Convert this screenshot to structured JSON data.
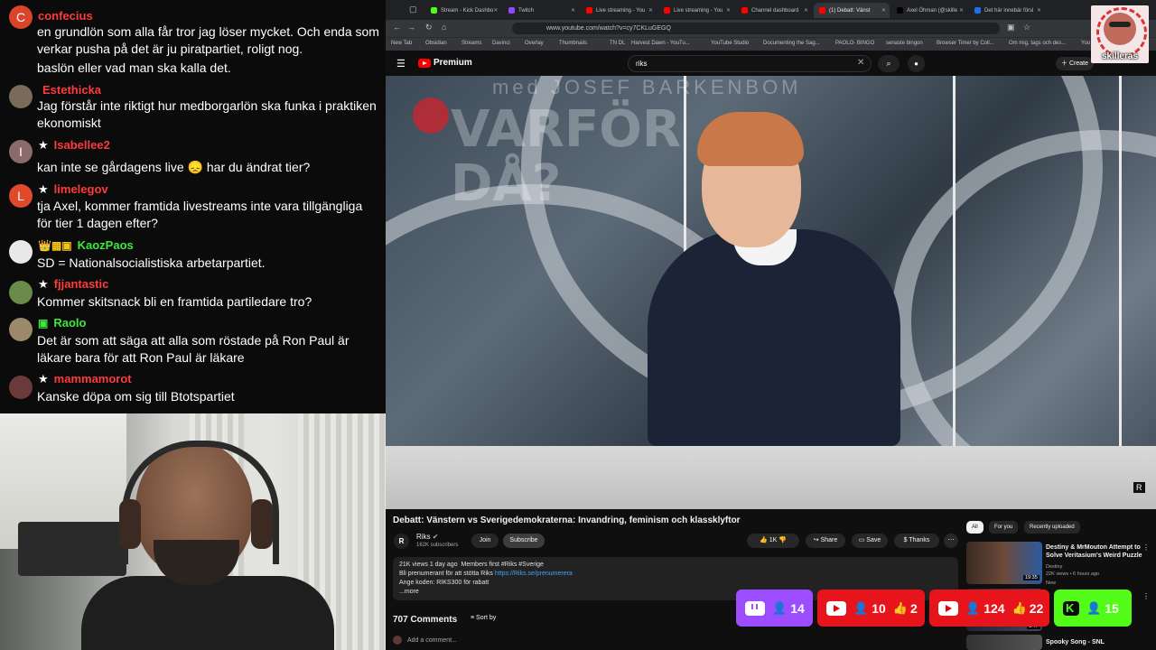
{
  "chat": {
    "messages": [
      {
        "user": "confecius",
        "user_color": "#ff3b3b",
        "avatar_letter": "C",
        "avatar_color": "#d9442b",
        "star": false,
        "badges": "",
        "text": "en grundlön som alla får tror jag löser mycket. Och enda som verkar pusha på det är ju piratpartiet, roligt nog."
      },
      {
        "user": "",
        "user_color": "#ff3b3b",
        "avatar_letter": "",
        "avatar_color": "",
        "star": false,
        "badges": "",
        "text": "baslön eller vad man ska kalla det."
      },
      {
        "user": "Estethicka",
        "user_color": "#ff3b3b",
        "avatar_letter": "",
        "avatar_color": "#7a6a5a",
        "star": false,
        "badges": "",
        "text": "Jag förstår inte riktigt hur medborgarlön ska funka i praktiken ekonomiskt"
      },
      {
        "user": "Isabellee2",
        "user_color": "#ff3b3b",
        "avatar_letter": "I",
        "avatar_color": "#8a6a6a",
        "star": true,
        "badges": "",
        "text": "kan inte se gårdagens live 😞 har du ändrat tier?"
      },
      {
        "user": "limelegov",
        "user_color": "#ff3b3b",
        "avatar_letter": "L",
        "avatar_color": "#e04a2b",
        "star": true,
        "badges": "",
        "text": "tja Axel, kommer framtida livestreams inte vara tillgängliga för tier 1 dagen efter?"
      },
      {
        "user": "KaozPaos",
        "user_color": "#3ee83e",
        "avatar_letter": "",
        "avatar_color": "#e8e8e8",
        "star": false,
        "badges": "👑▦▣",
        "text": "SD = Nationalsocialistiska arbetarpartiet."
      },
      {
        "user": "fjjantastic",
        "user_color": "#ff3b3b",
        "avatar_letter": "",
        "avatar_color": "#6a8a4a",
        "star": true,
        "badges": "",
        "text": "Kommer skitsnack bli en framtida partiledare tro?"
      },
      {
        "user": "Raolo",
        "user_color": "#3ee83e",
        "avatar_letter": "",
        "avatar_color": "#9a8a6a",
        "star": false,
        "badges": "▣",
        "text": "Det är som att säga att alla som röstade på Ron Paul är läkare bara för att Ron Paul är läkare"
      },
      {
        "user": "mammamorot",
        "user_color": "#ff3b3b",
        "avatar_letter": "",
        "avatar_color": "#6a3a3a",
        "star": true,
        "badges": "",
        "text": "Kanske döpa om sig till Btotspartiet"
      }
    ]
  },
  "browser": {
    "tabs": [
      {
        "label": "Stream - Kick Dashbo",
        "color": "#53fc18"
      },
      {
        "label": "Twitch",
        "color": "#9146ff"
      },
      {
        "label": "Live streaming - You",
        "color": "#ff0000"
      },
      {
        "label": "Live streaming - You",
        "color": "#ff0000"
      },
      {
        "label": "Channel dashboard",
        "color": "#ff0000"
      },
      {
        "label": "(1) Debatt: Vänst",
        "color": "#ff0000"
      },
      {
        "label": "Axel Öhman (@skille",
        "color": "#000000"
      },
      {
        "label": "Det här innebär försl",
        "color": "#1a73e8"
      }
    ],
    "url": "www.youtube.com/watch?v=cy7CKLuGEGQ",
    "bookmarks": [
      "New Tab",
      "Obsidian",
      "Streams",
      "Davinci",
      "Overlay",
      "Thumbnails",
      "TN DL",
      "Harvest Dawn - YouTu...",
      "YouTube Studio",
      "Documenting the Sag...",
      "PAOLO- BINGO",
      "senaste bingon",
      "Browser Timer by Coll...",
      "Om mig, tags och des...",
      "You"
    ]
  },
  "youtube": {
    "premium_label": "Premium",
    "search_value": "riks",
    "create_label": "Create",
    "video_overlay_title": "VARFÖR DÅ?",
    "video_overlay_sub": "med JOSEF BARKENBOM",
    "video_logo": "R",
    "video_title": "Debatt: Vänstern vs Sverigedemokraterna: Invandring, feminism och klassklyftor",
    "channel": {
      "name": "Riks",
      "subs": "162K subscribers",
      "avatar": "R"
    },
    "buttons": {
      "join": "Join",
      "subscribe": "Subscribe",
      "likes": "1K",
      "share": "Share",
      "save": "Save",
      "thanks": "Thanks"
    },
    "description": {
      "meta": "21K views  1 day ago",
      "tags": "Members first  #Riks #Sverige",
      "line1": "Bli prenumerant för att stötta Riks ",
      "link": "https://Riks.se/prenumerera",
      "line2": "Ange koden: RIKS300 för rabatt",
      "more": "...more"
    },
    "comments_count": "707 Comments",
    "sort_label": "Sort by",
    "add_comment": "Add a comment...",
    "chips": [
      "All",
      "For you",
      "Recently uploaded"
    ],
    "recommendations": [
      {
        "title": "Destiny & MrMouton Attempt to Solve Veritasium's Weird Puzzle",
        "channel": "Destiny",
        "meta": "22K views • 6 hours ago",
        "badge": "New",
        "duration": "19:35"
      },
      {
        "title": "",
        "channel": "",
        "meta": "",
        "badge": "",
        "duration": "1:47"
      },
      {
        "title": "Spooky Song - SNL",
        "channel": "",
        "meta": "",
        "badge": "",
        "duration": ""
      }
    ]
  },
  "brand": {
    "name": "skilleras"
  },
  "stats": {
    "twitch_viewers": "14",
    "yt1_viewers": "10",
    "yt1_likes": "2",
    "yt2_viewers": "124",
    "yt2_likes": "22",
    "kick_viewers": "15",
    "colors": {
      "twitch": "#9b4dff",
      "youtube": "#e8141b",
      "kick": "#53fc18"
    }
  }
}
